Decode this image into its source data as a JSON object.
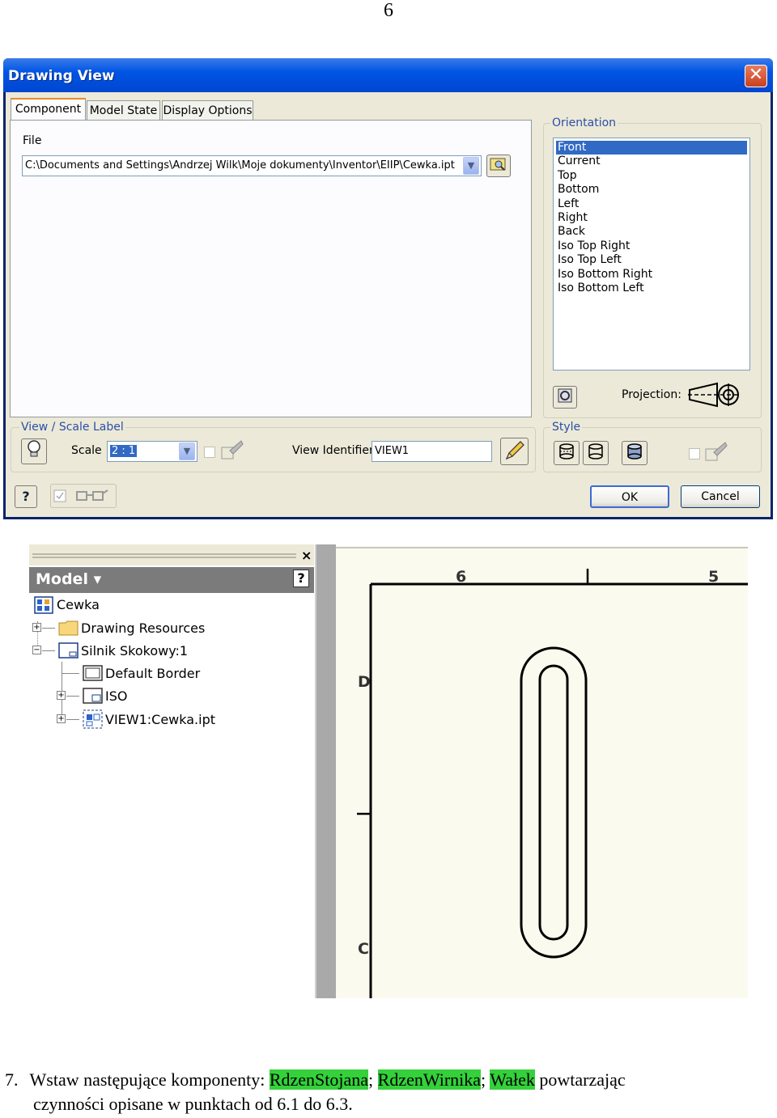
{
  "page_number": "6",
  "dialog": {
    "title": "Drawing View",
    "close_glyph": "✕",
    "tabs": [
      "Component",
      "Model State",
      "Display Options"
    ],
    "file_label": "File",
    "file_path": "C:\\Documents and Settings\\Andrzej Wilk\\Moje dokumenty\\Inventor\\EIIP\\Cewka.ipt",
    "orientation_label": "Orientation",
    "orientation_items": [
      "Front",
      "Current",
      "Top",
      "Bottom",
      "Left",
      "Right",
      "Back",
      "Iso Top Right",
      "Iso Top Left",
      "Iso Bottom Right",
      "Iso Bottom Left"
    ],
    "orientation_selected": "Front",
    "projection_label": "Projection:",
    "view_scale_label": "View / Scale Label",
    "scale_label": "Scale",
    "scale_value": "2 : 1",
    "view_identifier_label": "View Identifier",
    "view_identifier_value": "VIEW1",
    "style_label": "Style",
    "ok_label": "OK",
    "cancel_label": "Cancel",
    "help_glyph": "?"
  },
  "browser": {
    "close_glyph": "×",
    "title": "Model ▾",
    "help_glyph": "?",
    "tree": [
      {
        "label": "Cewka",
        "icon": "drawing-icon"
      },
      {
        "label": "Drawing Resources",
        "icon": "folder-icon"
      },
      {
        "label": "Silnik Skokowy:1",
        "icon": "sheet-icon"
      },
      {
        "label": "Default Border",
        "icon": "border-icon"
      },
      {
        "label": "ISO",
        "icon": "title-block-icon"
      },
      {
        "label": "VIEW1:Cewka.ipt",
        "icon": "view-icon"
      }
    ]
  },
  "sheet": {
    "col_labels": [
      "6",
      "5"
    ],
    "row_labels": [
      "D",
      "C"
    ]
  },
  "footer": {
    "number": "7.",
    "text_before": "Wstaw następujące komponenty: ",
    "comp1": "RdzenStojana",
    "sep1": "; ",
    "comp2": "RdzenWirnika",
    "sep2": "; ",
    "comp3": "Wałek",
    "text_after": " powtarzając",
    "line2": "czynności opisane w punktach od 6.1 do 6.3."
  },
  "colors": {
    "title_bar": "#0055e5",
    "selection": "#316ac5",
    "highlight": "#34d13b"
  }
}
